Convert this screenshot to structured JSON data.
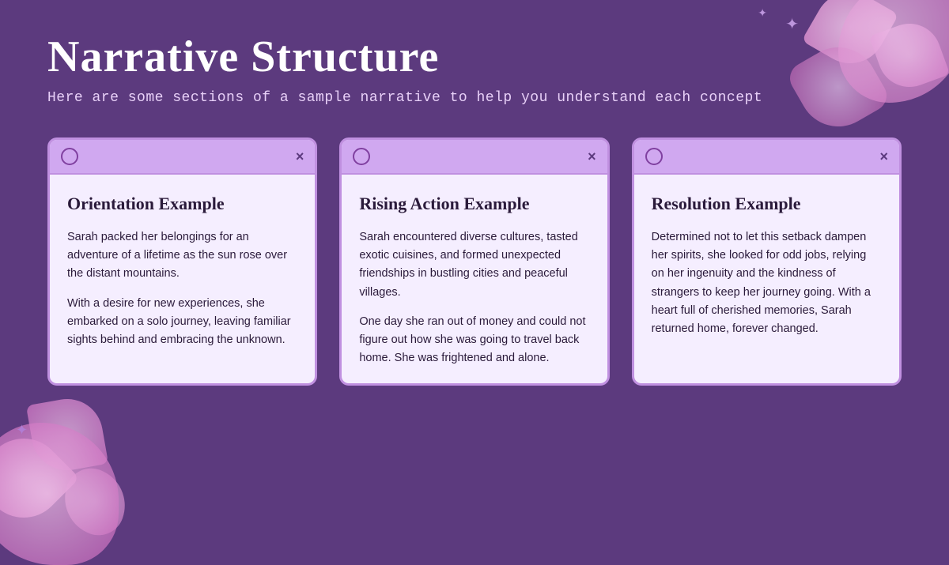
{
  "page": {
    "background_color": "#5c3a7e",
    "title": "Narrative Structure",
    "subtitle": "Here are some sections of a sample narrative to help you understand each concept"
  },
  "sparkles": [
    "✦",
    "✦",
    "✦",
    "✦"
  ],
  "cards": [
    {
      "id": "orientation",
      "titlebar_circle": "○",
      "titlebar_x": "×",
      "title": "Orientation Example",
      "paragraphs": [
        "Sarah packed her belongings for an adventure of a lifetime as the sun rose over the distant mountains.",
        "With a desire for new experiences, she embarked on a solo journey, leaving familiar sights behind and embracing the unknown."
      ]
    },
    {
      "id": "rising-action",
      "titlebar_circle": "○",
      "titlebar_x": "×",
      "title": "Rising Action Example",
      "paragraphs": [
        "Sarah encountered diverse cultures, tasted exotic cuisines, and formed unexpected friendships in bustling cities and peaceful villages.",
        "One day she ran out of money and could not figure out how she was going to travel back home. She was frightened and alone."
      ]
    },
    {
      "id": "resolution",
      "titlebar_circle": "○",
      "titlebar_x": "×",
      "title": "Resolution Example",
      "paragraphs": [
        "Determined not to let this setback dampen her spirits, she looked for odd jobs, relying on her ingenuity and the kindness of strangers to keep her journey going. With a heart full of cherished memories, Sarah returned home, forever changed."
      ]
    }
  ]
}
